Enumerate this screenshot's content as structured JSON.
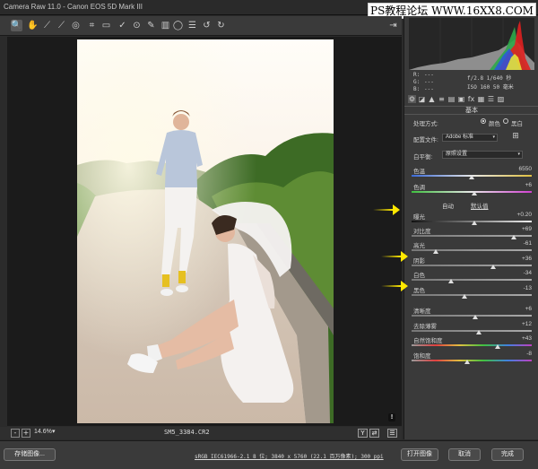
{
  "window": {
    "title": "Camera Raw 11.0 - Canon EOS 5D Mark III"
  },
  "watermark": {
    "text": "PS教程论坛 WWW.16XX8.COM"
  },
  "toolbar": {
    "tools": [
      "zoom-icon",
      "hand-icon",
      "white-balance-icon",
      "color-sampler-icon",
      "targeted-adjustment-icon",
      "crop-icon",
      "straighten-icon",
      "spot-removal-icon",
      "red-eye-icon",
      "adjustment-brush-icon",
      "graduated-filter-icon",
      "radial-filter-icon",
      "preferences-icon",
      "rotate-ccw-icon",
      "rotate-cw-icon"
    ],
    "tool_glyphs": [
      "🔍",
      "✋",
      "⟋",
      "⟋",
      "◎",
      "⌗",
      "▭",
      "✓",
      "⊙",
      "✎",
      "▥",
      "◯",
      "☰",
      "↺",
      "↻"
    ],
    "export_glyph": "⇥"
  },
  "status": {
    "zoom_minus": "-",
    "zoom_plus": "+",
    "zoom": "14.6%",
    "zoom_arrow": "▾",
    "filename": "SM5_3384.CR2",
    "view_y": "Y",
    "view_toggle": "⇄",
    "view_menu": "☰",
    "warning": "!"
  },
  "bottom": {
    "save_label": "存储图像...",
    "info_link": "sRGB IEC61966-2.1 8 位; 3840 x 5760 (22.1 百万像素); 300 ppi",
    "open_label": "打开图像",
    "cancel_label": "取消",
    "done_label": "完成"
  },
  "histogram": {
    "r_label": "R:",
    "r_value": "---",
    "g_label": "G:",
    "g_value": "---",
    "b_label": "B:",
    "b_value": "---",
    "exposure": "f/2.8   1/640 秒",
    "iso": "ISO 160   50 毫米"
  },
  "panel": {
    "tab_glyphs": [
      "⚙",
      "◪",
      "▲",
      "≡",
      "▤",
      "▣",
      "fx",
      "▦",
      "☰",
      "▨"
    ],
    "section": "基本",
    "treatment_label": "处理方式:",
    "treatment_color": "颜色",
    "treatment_bw": "黑白",
    "profile_label": "配置文件:",
    "profile_value": "Adobe 标准",
    "wb_label": "白平衡:",
    "wb_value": "原照设置",
    "dropdown_arrow": "▾",
    "auto": "自动",
    "default": "默认值",
    "sliders": [
      {
        "label": "色温",
        "value": "6550",
        "pos": 0.5
      },
      {
        "label": "色调",
        "value": "+6",
        "pos": 0.52
      },
      {
        "label": "曝光",
        "value": "+0.20",
        "pos": 0.52
      },
      {
        "label": "对比度",
        "value": "+69",
        "pos": 0.85
      },
      {
        "label": "高光",
        "value": "-61",
        "pos": 0.2
      },
      {
        "label": "阴影",
        "value": "+36",
        "pos": 0.68
      },
      {
        "label": "白色",
        "value": "-34",
        "pos": 0.33
      },
      {
        "label": "黑色",
        "value": "-13",
        "pos": 0.44
      },
      {
        "label": "清晰度",
        "value": "+6",
        "pos": 0.53
      },
      {
        "label": "去除薄雾",
        "value": "+12",
        "pos": 0.56
      },
      {
        "label": "自然饱和度",
        "value": "+43",
        "pos": 0.72
      },
      {
        "label": "饱和度",
        "value": "-8",
        "pos": 0.46
      }
    ]
  },
  "colors": {
    "accent_arrow": "#ffe800",
    "panel_bg": "#3a3a3a",
    "canvas_bg": "#1b1b1b"
  }
}
